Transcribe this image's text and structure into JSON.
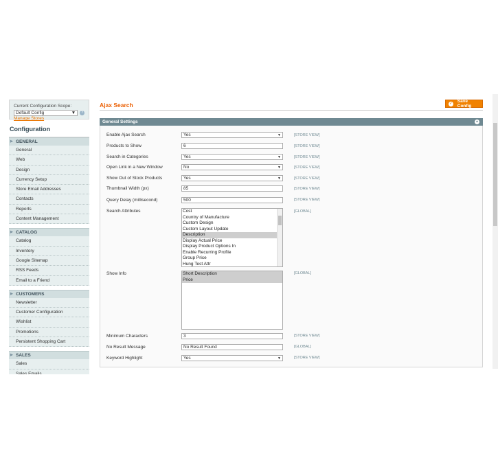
{
  "sidebar": {
    "scope_label": "Current Configuration Scope:",
    "scope_value": "Default Config",
    "manage_stores": "Manage Stores",
    "title": "Configuration",
    "groups": [
      {
        "name": "GENERAL",
        "items": [
          "General",
          "Web",
          "Design",
          "Currency Setup",
          "Store Email Addresses",
          "Contacts",
          "Reports",
          "Content Management"
        ]
      },
      {
        "name": "CATALOG",
        "items": [
          "Catalog",
          "Inventory",
          "Google Sitemap",
          "RSS Feeds",
          "Email to a Friend"
        ]
      },
      {
        "name": "CUSTOMERS",
        "items": [
          "Newsletter",
          "Customer Configuration",
          "Wishlist",
          "Promotions",
          "Persistent Shopping Cart"
        ]
      },
      {
        "name": "SALES",
        "items": [
          "Sales",
          "Sales Emails"
        ]
      }
    ]
  },
  "main": {
    "title": "Ajax Search",
    "save_label": "Save Config",
    "section_title": "General Settings"
  },
  "form": {
    "enable": {
      "label": "Enable Ajax Search",
      "value": "Yes",
      "scope": "[STORE VIEW]"
    },
    "products": {
      "label": "Products to Show",
      "value": "6",
      "scope": "[STORE VIEW]"
    },
    "search_cat": {
      "label": "Search in Categories",
      "value": "Yes",
      "scope": "[STORE VIEW]"
    },
    "new_window": {
      "label": "Open Link in a New Window",
      "value": "No",
      "scope": "[STORE VIEW]"
    },
    "out_of_stock": {
      "label": "Show Out of Stock Products",
      "value": "Yes",
      "scope": "[STORE VIEW]"
    },
    "thumb_width": {
      "label": "Thumbnail Width (px)",
      "value": "85",
      "scope": "[STORE VIEW]"
    },
    "query_delay": {
      "label": "Query Delay (millisecond)",
      "value": "500",
      "scope": "[STORE VIEW]"
    },
    "attributes": {
      "label": "Search Attributes",
      "scope": "[GLOBAL]",
      "options": [
        "Cost",
        "Country of Manufacture",
        "Custom Design",
        "Custom Layout Update",
        "Description",
        "Display Actual Price",
        "Display Product Options In",
        "Enable Recurring Profile",
        "Group Price",
        "Hung Test Attr"
      ],
      "selected": [
        "Description"
      ]
    },
    "show_info": {
      "label": "Show Info",
      "scope": "[GLOBAL]",
      "options": [
        "Short Description",
        "Price"
      ],
      "selected": [
        "Short Description",
        "Price"
      ]
    },
    "min_chars": {
      "label": "Minimum Characters",
      "value": "3",
      "scope": "[STORE VIEW]"
    },
    "no_result": {
      "label": "No Result Message",
      "value": "No Result Found",
      "scope": "[GLOBAL]"
    },
    "highlight": {
      "label": "Keyword Highlight",
      "value": "Yes",
      "scope": "[STORE VIEW]"
    }
  }
}
